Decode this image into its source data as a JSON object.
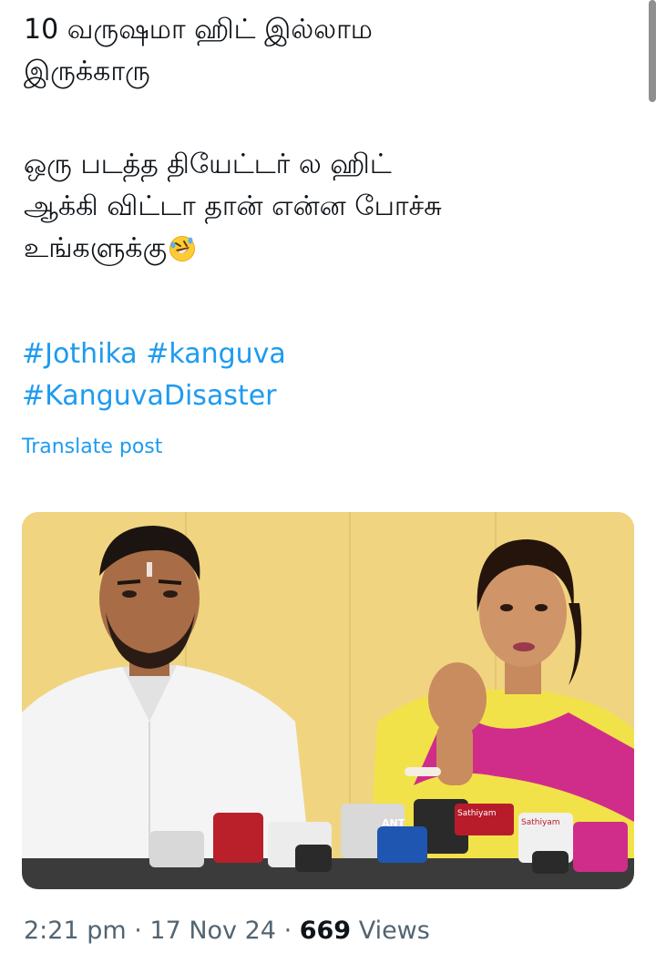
{
  "tweet": {
    "lines_para1": [
      "10 வருஷமா ஹிட் இல்லாம",
      "இருக்காரு"
    ],
    "lines_para2": [
      "ஒரு படத்த தியேட்டர் ல ஹிட்",
      "ஆக்கி விட்டா தான் என்ன போச்சு",
      "உங்களுக்கு"
    ],
    "emoji": "rolling-on-floor-laughing-emoji",
    "hashtags": [
      "#Jothika",
      "#kanguva",
      "#KanguvaDisaster"
    ],
    "translate_label": "Translate post"
  },
  "media": {
    "description_icon": "press-conference-photo",
    "mic_labels": [
      "Sathiyam",
      "ANT",
      "Sathiyam"
    ]
  },
  "meta": {
    "time": "2:21 pm",
    "separator1": " · ",
    "date": "17 Nov 24",
    "separator2": " · ",
    "views_count": "669",
    "views_label": " Views"
  },
  "colors": {
    "link": "#1d9bf0",
    "text": "#0f1419",
    "secondary": "#536471",
    "wall": "#efd27a"
  }
}
